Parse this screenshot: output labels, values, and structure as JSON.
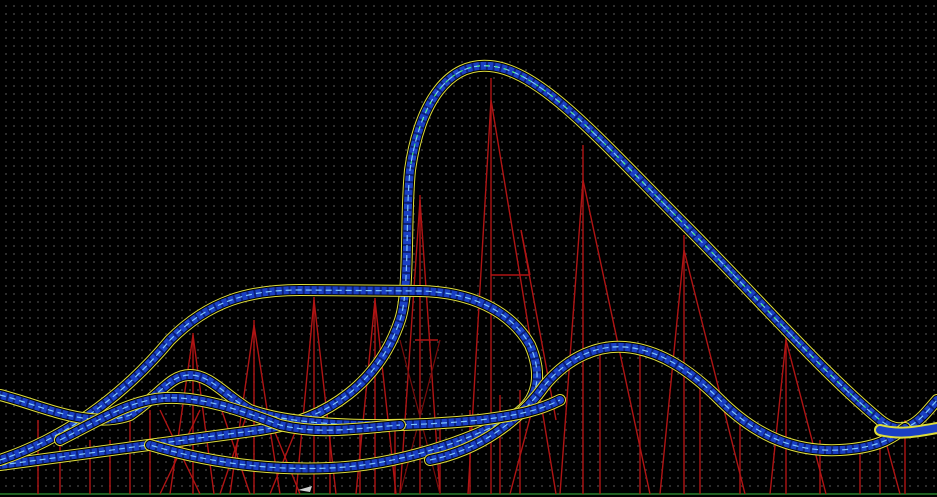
{
  "editor": {
    "view": "side-elevation",
    "grid": true,
    "background_color": "#000000",
    "grid_color": "#3a3a3a"
  },
  "track": {
    "rail_color": "#1a3fc4",
    "edge_color": "#dede3a",
    "spine_color": "#7ec8ff",
    "accent_color": "#44ff66",
    "segments": [
      "main-hill",
      "overbank-hill",
      "camelback-right",
      "small-hill-left",
      "lower-return",
      "far-right-exit"
    ]
  },
  "supports": {
    "color": "#b01414"
  },
  "brake_run": {
    "color": "#d020d0"
  }
}
